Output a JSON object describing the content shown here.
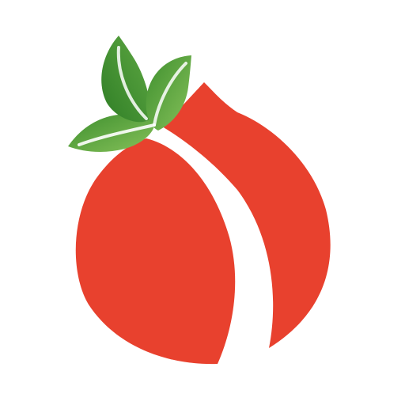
{
  "logo": {
    "icon": "peach-fruit-with-leaves-icon",
    "colors": {
      "fruit_red": "#E8412E",
      "leaf_dark_green": "#3E8F2E",
      "leaf_light_green": "#86C15A",
      "leaf_vein": "#FFFFFF",
      "background": "#FFFFFF"
    }
  }
}
